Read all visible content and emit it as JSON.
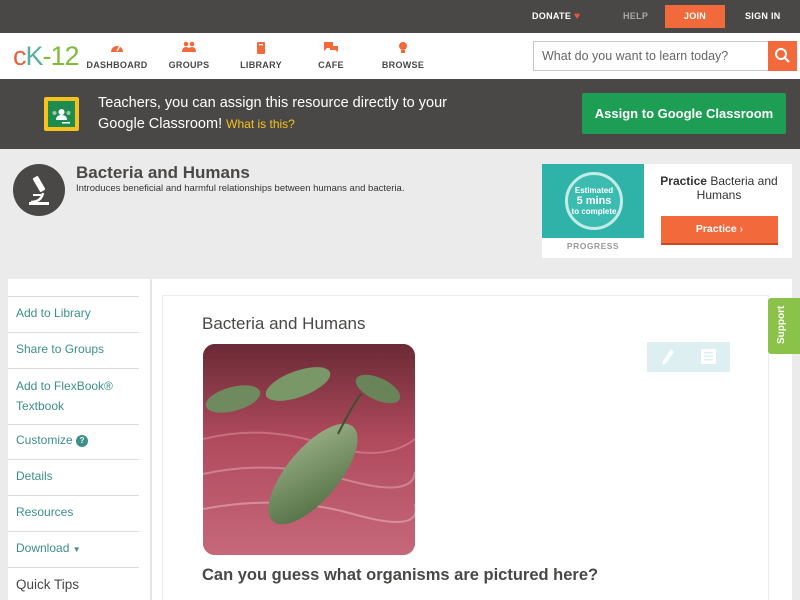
{
  "topbar": {
    "donate": "DONATE",
    "help": "HELP",
    "join": "JOIN",
    "signin": "SIGN IN"
  },
  "brand": {
    "logo_c": "c",
    "logo_k": "K",
    "logo_n": "-12"
  },
  "nav": {
    "items": [
      {
        "label": "DASHBOARD",
        "icon": "dashboard-icon"
      },
      {
        "label": "GROUPS",
        "icon": "groups-icon"
      },
      {
        "label": "LIBRARY",
        "icon": "library-icon"
      },
      {
        "label": "CAFE",
        "icon": "cafe-icon"
      },
      {
        "label": "BROWSE",
        "icon": "browse-icon"
      }
    ]
  },
  "search": {
    "placeholder": "What do you want to learn today?"
  },
  "banner": {
    "text": "Teachers, you can assign this resource directly to your Google Classroom!",
    "what_link": "What is this?",
    "assign_button": "Assign to Google Classroom"
  },
  "header": {
    "title": "Bacteria and Humans",
    "subtitle": "Introduces beneficial and harmful relationships between humans and bacteria."
  },
  "practice": {
    "estimated": "Estimated",
    "mins": "5 mins",
    "to_complete": "to complete",
    "progress_label": "PROGRESS",
    "title_bold": "Practice",
    "title_rest": "Bacteria and Humans",
    "button": "Practice"
  },
  "sidebar": {
    "add_library": "Add to Library",
    "share_groups": "Share to Groups",
    "add_flexbook": "Add to FlexBook® Textbook",
    "customize": "Customize",
    "details": "Details",
    "resources": "Resources",
    "download": "Download",
    "quick_tips": "Quick Tips"
  },
  "content": {
    "title": "Bacteria and Humans",
    "question": "Can you guess what organisms are pictured here?"
  },
  "support": "Support",
  "colors": {
    "accent": "#f26a3c",
    "dark": "#4a4846",
    "link": "#3d8f8a",
    "google_green": "#1e9e55",
    "support_green": "#8bc34a"
  }
}
